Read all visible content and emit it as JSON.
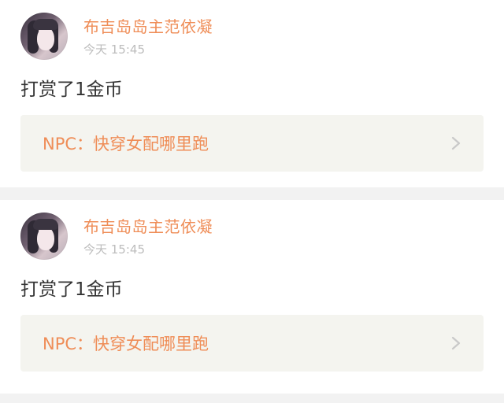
{
  "posts": [
    {
      "username": "布吉岛岛主范依凝",
      "time": "今天 15:45",
      "content": "打赏了1金币",
      "book_title": "NPC：快穿女配哪里跑"
    },
    {
      "username": "布吉岛岛主范依凝",
      "time": "今天 15:45",
      "content": "打赏了1金币",
      "book_title": "NPC：快穿女配哪里跑"
    }
  ],
  "icons": {
    "chevron": "chevron-right-icon"
  },
  "colors": {
    "accent": "#ef8d57",
    "text": "#333333",
    "muted": "#bdbdbd",
    "card_bg": "#f4f4ef",
    "page_bg": "#f2f2f2"
  }
}
